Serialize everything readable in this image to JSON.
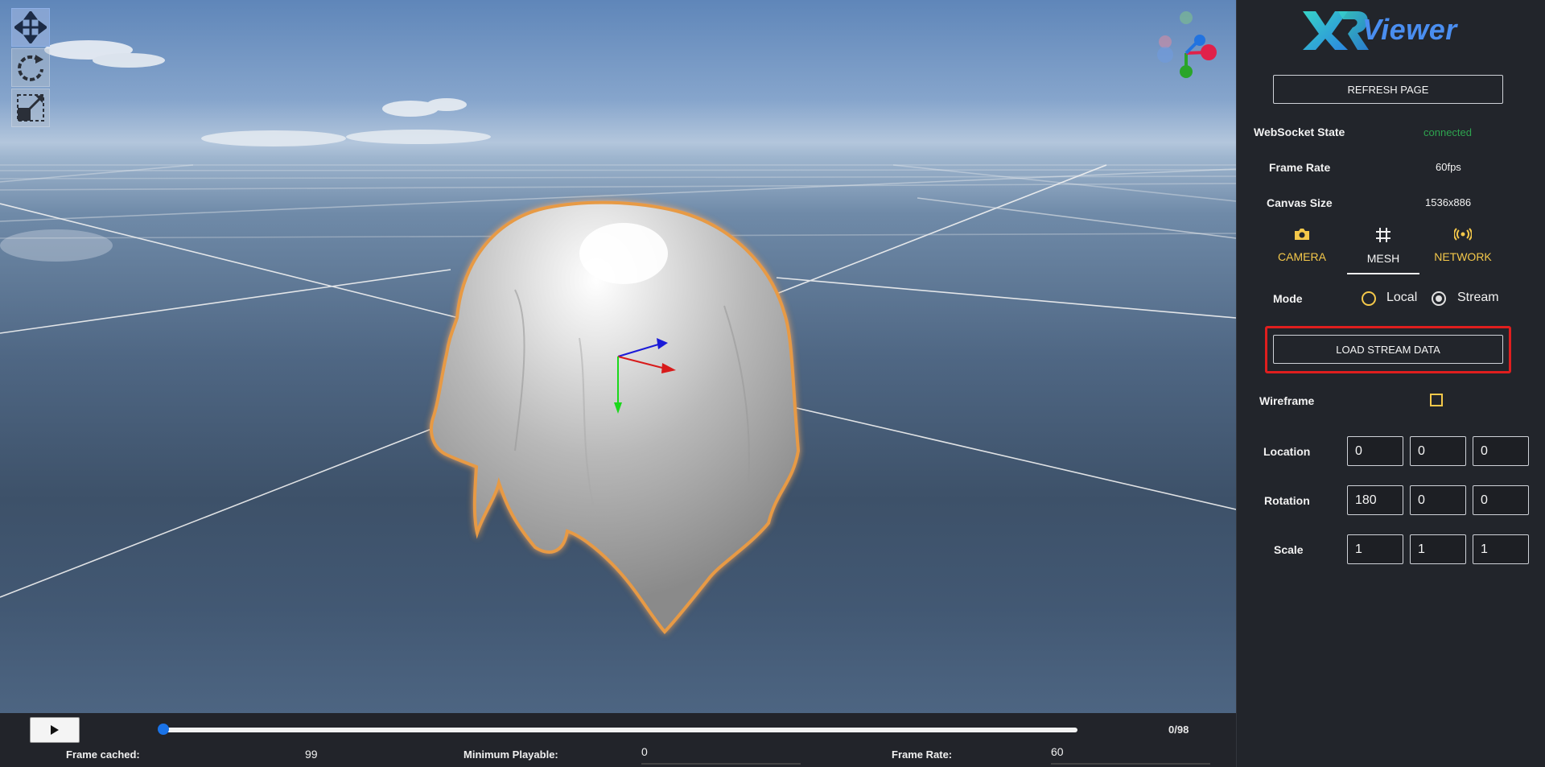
{
  "toolbar": {
    "tools": [
      {
        "name": "move-icon",
        "active": true
      },
      {
        "name": "rotate-icon",
        "active": false
      },
      {
        "name": "scale-icon",
        "active": false
      }
    ]
  },
  "playback": {
    "play_icon": "play-icon",
    "frame_counter": "0/98",
    "progress": 0.0,
    "stats": {
      "frame_cached_label": "Frame cached:",
      "frame_cached_value": "99",
      "min_playable_label": "Minimum Playable:",
      "min_playable_value": "0",
      "frame_rate_label": "Frame Rate:",
      "frame_rate_value": "60"
    }
  },
  "panel": {
    "logo_text": "Viewer",
    "refresh_label": "REFRESH PAGE",
    "info": {
      "ws_label": "WebSocket State",
      "ws_value": "connected",
      "fr_label": "Frame Rate",
      "fr_value": "60fps",
      "cs_label": "Canvas Size",
      "cs_value": "1536x886"
    },
    "tabs": {
      "camera": "CAMERA",
      "mesh": "MESH",
      "network": "NETWORK",
      "active": "MESH"
    },
    "mode": {
      "label": "Mode",
      "local": "Local",
      "stream": "Stream",
      "selected": "Stream"
    },
    "load_label": "LOAD STREAM DATA",
    "wireframe_label": "Wireframe",
    "wireframe_checked": false,
    "location": {
      "label": "Location",
      "x": "0",
      "y": "0",
      "z": "0"
    },
    "rotation": {
      "label": "Rotation",
      "x": "180",
      "y": "0",
      "z": "0"
    },
    "scale": {
      "label": "Scale",
      "x": "1",
      "y": "1",
      "z": "1"
    }
  },
  "colors": {
    "accent_yellow": "#f4c84a",
    "connected_green": "#2ea44f",
    "highlight_red": "#e01e1e",
    "slider_blue": "#1a73e8"
  }
}
